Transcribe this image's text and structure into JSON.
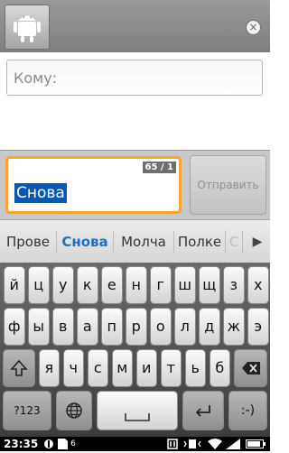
{
  "recipients": {
    "label": "Кому:"
  },
  "compose": {
    "counter": "65 / 1",
    "message": "Снова",
    "send_label": "Отправить"
  },
  "suggestions": {
    "items": [
      {
        "label": "Прове",
        "active": false
      },
      {
        "label": "Снова",
        "active": true
      },
      {
        "label": "Молча",
        "active": false
      },
      {
        "label": "Полке",
        "active": false
      },
      {
        "label": "С",
        "active": false
      }
    ],
    "accent_color": "#1a6fc4"
  },
  "keyboard": {
    "rows": [
      [
        "й",
        "ц",
        "у",
        "к",
        "е",
        "н",
        "г",
        "ш",
        "щ",
        "з",
        "х"
      ],
      [
        "ф",
        "ы",
        "в",
        "а",
        "п",
        "р",
        "о",
        "л",
        "д",
        "ж",
        "э"
      ],
      [
        "я",
        "ч",
        "с",
        "м",
        "и",
        "т",
        "ь",
        "б",
        "ю"
      ]
    ],
    "symbols_label": "?123",
    "punct_label": ":-)",
    "icons": {
      "shift": "shift-icon",
      "backspace": "backspace-icon",
      "language": "globe-icon",
      "space": "space-icon",
      "enter": "enter-icon"
    }
  },
  "statusbar": {
    "time": "23:35",
    "notification_count": "6",
    "icons": [
      "usb-icon",
      "sim-icon",
      "notification-icon",
      "nfc-icon",
      "vibrate-icon",
      "wifi-icon",
      "signal-icon",
      "battery-icon"
    ]
  },
  "colors": {
    "selection": "#0a57b0",
    "focus_border": "#f7a433"
  }
}
